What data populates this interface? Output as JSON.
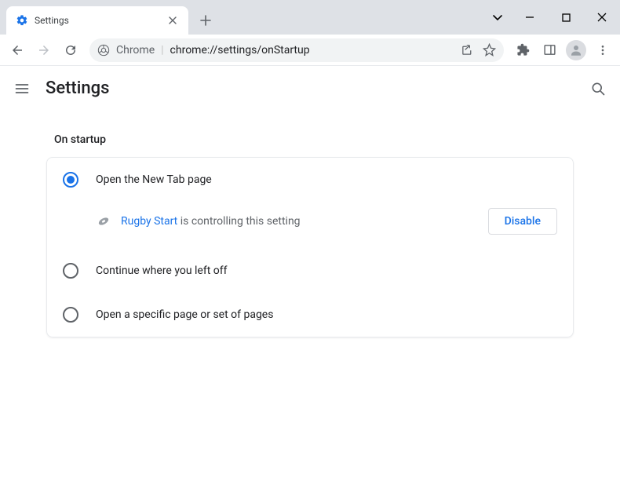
{
  "tab": {
    "title": "Settings"
  },
  "omnibox": {
    "prefix": "Chrome",
    "url": "chrome://settings/onStartup"
  },
  "appbar": {
    "title": "Settings"
  },
  "section": {
    "title": "On startup"
  },
  "options": {
    "new_tab": "Open the New Tab page",
    "continue": "Continue where you left off",
    "specific": "Open a specific page or set of pages"
  },
  "extension": {
    "name": "Rugby Start",
    "controlling_text": " is controlling this setting",
    "disable_label": "Disable"
  }
}
